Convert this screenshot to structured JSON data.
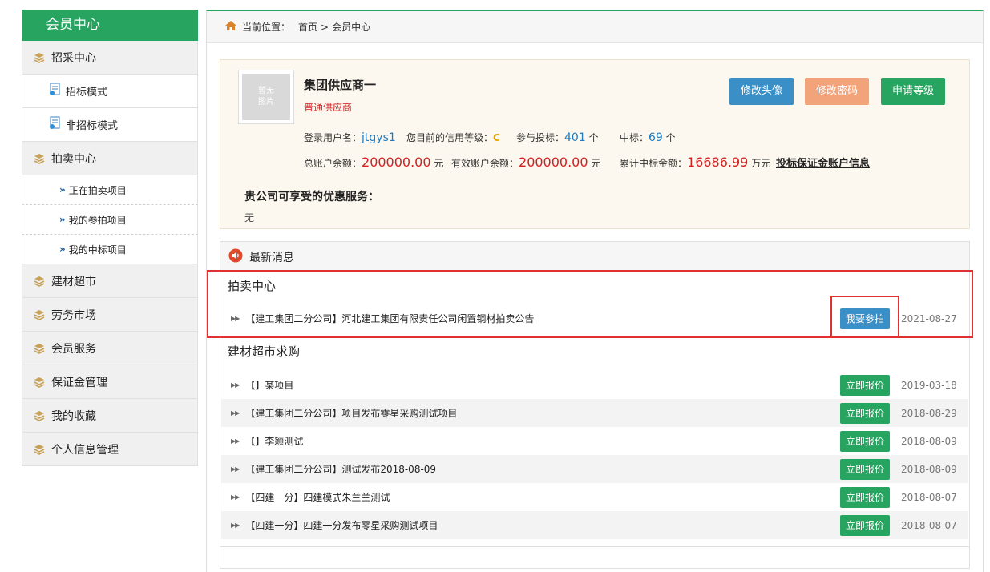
{
  "sidebar": {
    "title": "会员中心",
    "items": [
      {
        "label": "招采中心",
        "type": "main"
      },
      {
        "label": "招标模式",
        "type": "sub"
      },
      {
        "label": "非招标模式",
        "type": "sub"
      },
      {
        "label": "拍卖中心",
        "type": "main"
      },
      {
        "label": "正在拍卖项目",
        "type": "sub2"
      },
      {
        "label": "我的参拍项目",
        "type": "sub2"
      },
      {
        "label": "我的中标项目",
        "type": "sub2"
      },
      {
        "label": "建材超市",
        "type": "main"
      },
      {
        "label": "劳务市场",
        "type": "main"
      },
      {
        "label": "会员服务",
        "type": "main"
      },
      {
        "label": "保证金管理",
        "type": "main"
      },
      {
        "label": "我的收藏",
        "type": "main"
      },
      {
        "label": "个人信息管理",
        "type": "main"
      }
    ]
  },
  "breadcrumb": {
    "prefix": "当前位置：",
    "home": "首页",
    "sep": ">",
    "current": "会员中心"
  },
  "profile": {
    "avatar_text_1": "暂无",
    "avatar_text_2": "图片",
    "company": "集团供应商一",
    "level": "普通供应商",
    "btn_avatar": "修改头像",
    "btn_password": "修改密码",
    "btn_level": "申请等级",
    "username_label": "登录用户名：",
    "username": "jtgys1",
    "credit_label": "您目前的信用等级：",
    "credit": "C",
    "bid_label": "参与投标：",
    "bid_count": "401",
    "bid_unit": "个",
    "win_label": "中标：",
    "win_count": "69",
    "win_unit": "个",
    "total_label": "总账户余额：",
    "total": "200000.00",
    "total_unit": "元",
    "valid_label": "有效账户余额：",
    "valid": "200000.00",
    "valid_unit": "元",
    "cum_label": "累计中标金额：",
    "cum": "16686.99",
    "cum_unit": "万元",
    "deposit_link": "投标保证金账户信息",
    "benefit_title": "贵公司可享受的优惠服务：",
    "benefit_value": "无"
  },
  "news": {
    "header": "最新消息",
    "auction_title": "拍卖中心",
    "auction_rows": [
      {
        "title": "【建工集团二分公司】河北建工集团有限责任公司闲置钢材拍卖公告",
        "action": "我要参拍",
        "date": "2021-08-27"
      }
    ],
    "market_title": "建材超市求购",
    "market_rows": [
      {
        "title": "【】某项目",
        "action": "立即报价",
        "date": "2019-03-18"
      },
      {
        "title": "【建工集团二分公司】项目发布零星采购测试项目",
        "action": "立即报价",
        "date": "2018-08-29"
      },
      {
        "title": "【】李颖测试",
        "action": "立即报价",
        "date": "2018-08-09"
      },
      {
        "title": "【建工集团二分公司】测试发布2018-08-09",
        "action": "立即报价",
        "date": "2018-08-09"
      },
      {
        "title": "【四建一分】四建模式朱兰兰测试",
        "action": "立即报价",
        "date": "2018-08-07"
      },
      {
        "title": "【四建一分】四建一分发布零星采购测试项目",
        "action": "立即报价",
        "date": "2018-08-07"
      }
    ]
  },
  "colors": {
    "brand": "#27a560",
    "blue": "#3a8fc6",
    "orange": "#f2a37a",
    "highlight": "#e03030"
  }
}
